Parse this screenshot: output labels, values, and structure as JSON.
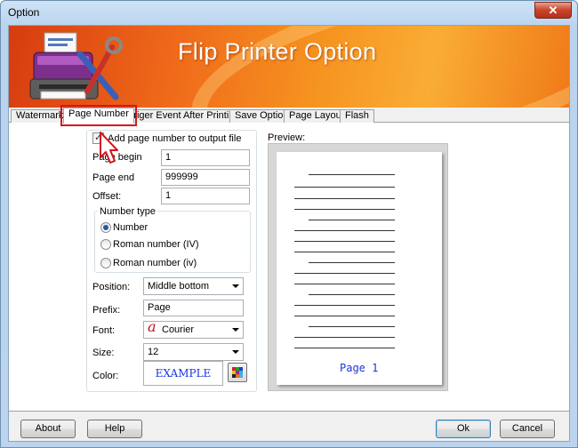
{
  "window": {
    "title": "Option",
    "close_glyph": "✕"
  },
  "banner": {
    "title": "Flip Printer Option"
  },
  "tabs": [
    {
      "label": "Watermark"
    },
    {
      "label": "Page Number",
      "active": true
    },
    {
      "label": "Triger Event After Printing"
    },
    {
      "label": "Save Option"
    },
    {
      "label": "Page Layout"
    },
    {
      "label": "Flash"
    }
  ],
  "page_number": {
    "add_checkbox_label": "Add page number to output file",
    "add_checked": true,
    "page_begin_label": "Page begin",
    "page_begin_value": "1",
    "page_end_label": "Page end",
    "page_end_value": "999999",
    "offset_label": "Offset:",
    "offset_value": "1",
    "number_type": {
      "legend": "Number type",
      "options": [
        {
          "label": "Number",
          "checked": true
        },
        {
          "label": "Roman number (IV)",
          "checked": false
        },
        {
          "label": "Roman number (iv)",
          "checked": false
        }
      ]
    },
    "position_label": "Position:",
    "position_value": "Middle bottom",
    "prefix_label": "Prefix:",
    "prefix_value": "Page",
    "font_label": "Font:",
    "font_value": "Courier",
    "font_icon_glyph": "a",
    "size_label": "Size:",
    "size_value": "12",
    "color_label": "Color:",
    "color_example": "EXAMPLE",
    "color_value": "#1a34e0"
  },
  "preview": {
    "label": "Preview:",
    "page_number_text": "Page 1"
  },
  "buttons": {
    "about": "About",
    "help": "Help",
    "ok": "Ok",
    "cancel": "Cancel"
  },
  "colors": {
    "accent_red": "#d6141a",
    "banner_orange": "#f69320",
    "preview_text": "#1a34e0"
  }
}
